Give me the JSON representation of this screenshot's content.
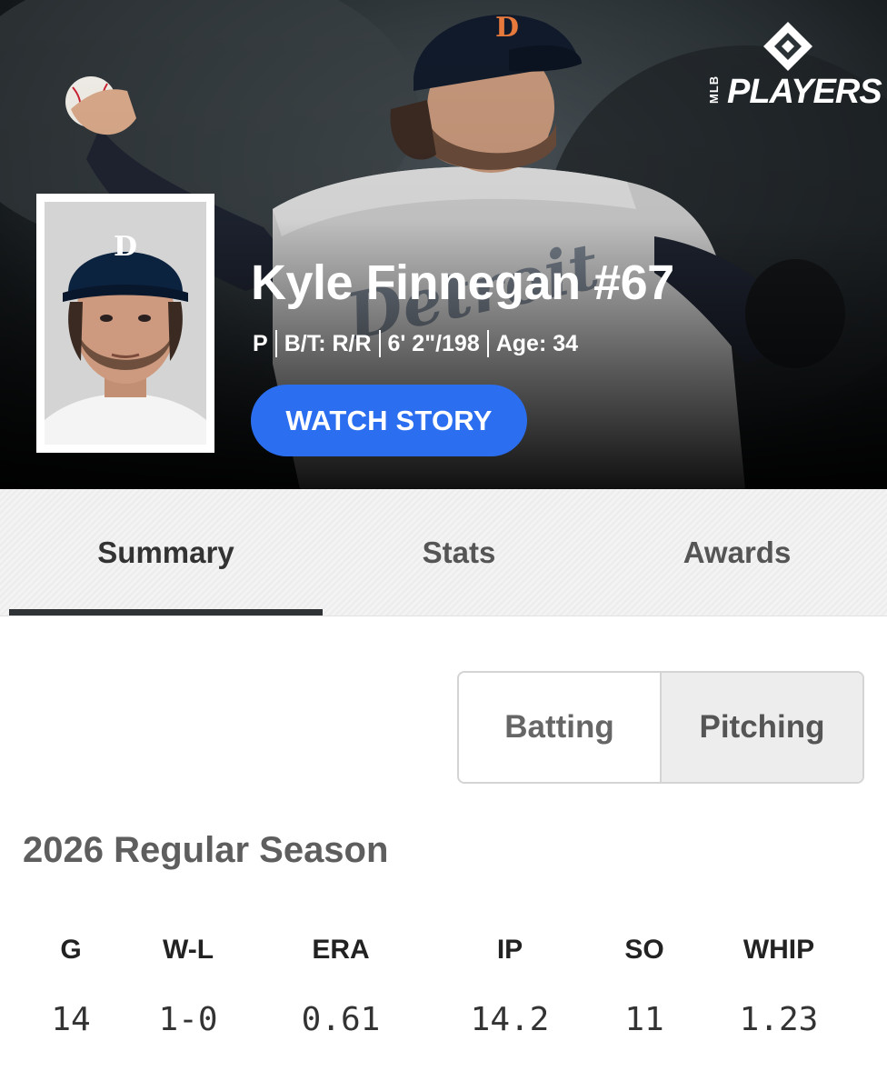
{
  "brand": {
    "logo_text": "PLAYERS",
    "logo_sub": "MLB"
  },
  "player": {
    "name": "Kyle Finnegan #67",
    "position": "P",
    "bats_throws": "B/T: R/R",
    "height_weight": "6' 2\"/198",
    "age": "Age: 34",
    "cap_letter": "D"
  },
  "hero": {
    "watch_label": "WATCH STORY"
  },
  "tabs": [
    {
      "label": "Summary",
      "active": true
    },
    {
      "label": "Stats",
      "active": false
    },
    {
      "label": "Awards",
      "active": false
    }
  ],
  "toggle": {
    "options": [
      {
        "label": "Batting",
        "selected": false
      },
      {
        "label": "Pitching",
        "selected": true
      }
    ]
  },
  "season": {
    "title": "2026 Regular Season",
    "columns": [
      "G",
      "W-L",
      "ERA",
      "IP",
      "SO",
      "WHIP"
    ],
    "values": [
      "14",
      "1-0",
      "0.61",
      "14.2",
      "11",
      "1.23"
    ]
  },
  "colors": {
    "accent_blue": "#2b6ff0",
    "tab_underline": "#2f3336",
    "tigers_navy": "#0c2340",
    "tigers_orange": "#fa4616"
  }
}
